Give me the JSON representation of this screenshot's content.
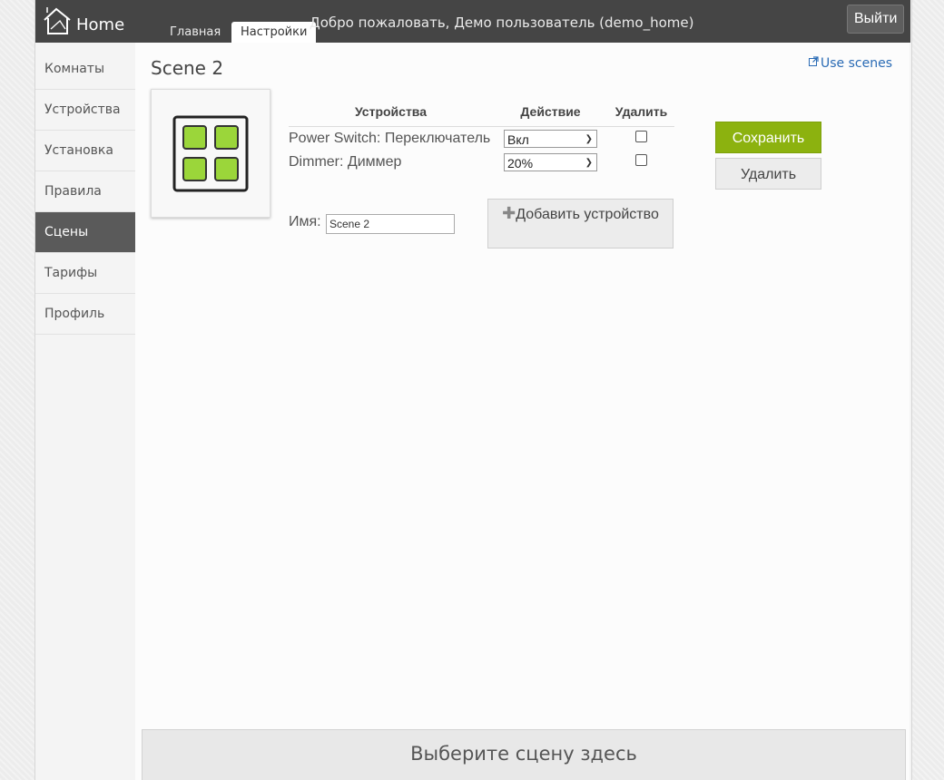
{
  "app": {
    "brand": "Home"
  },
  "nav": {
    "tabs": [
      {
        "label": "Главная",
        "active": false
      },
      {
        "label": "Настройки",
        "active": true
      }
    ],
    "welcome": "Добро пожаловать, Демо пользователь (demo_home)",
    "logout_label": "Выйти"
  },
  "sidebar": {
    "items": [
      {
        "label": "Комнаты",
        "active": false
      },
      {
        "label": "Устройства",
        "active": false
      },
      {
        "label": "Установка",
        "active": false
      },
      {
        "label": "Правила",
        "active": false
      },
      {
        "label": "Сцены",
        "active": true
      },
      {
        "label": "Тарифы",
        "active": false
      },
      {
        "label": "Профиль",
        "active": false
      }
    ]
  },
  "scene": {
    "title": "Scene 2",
    "help_link": "Use scenes",
    "icon": "scene-grid-icon",
    "table": {
      "headers": {
        "device": "Устройства",
        "action": "Действие",
        "delete": "Удалить"
      },
      "rows": [
        {
          "device": "Power Switch: Переключатель",
          "action": "Вкл",
          "delete": false
        },
        {
          "device": "Dimmer: Диммер",
          "action": "20%",
          "delete": false
        }
      ]
    },
    "name_label": "Имя:",
    "name_value": "Scene 2",
    "add_device_label": "Добавить устройство",
    "save_label": "Сохранить",
    "delete_label": "Удалить"
  },
  "footer": {
    "select_scene_label": "Выберите сцену здесь"
  },
  "colors": {
    "topbar": "#454545",
    "accent_green": "#8cb20f",
    "link": "#2a6bb5",
    "tile_green": "#9bd63a"
  }
}
